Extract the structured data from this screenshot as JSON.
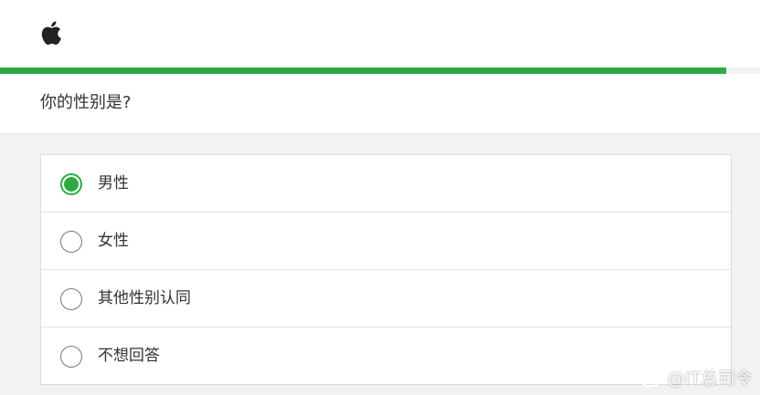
{
  "header": {
    "logo_icon": "apple-logo-icon"
  },
  "progress": {
    "fraction": 0.955,
    "color": "#2ea942"
  },
  "question": {
    "text": "你的性别是?"
  },
  "options": [
    {
      "label": "男性",
      "selected": true
    },
    {
      "label": "女性",
      "selected": false
    },
    {
      "label": "其他性别认同",
      "selected": false
    },
    {
      "label": "不想回答",
      "selected": false
    }
  ],
  "watermark": {
    "text": "@IT总司令",
    "icon": "weibo-icon"
  }
}
